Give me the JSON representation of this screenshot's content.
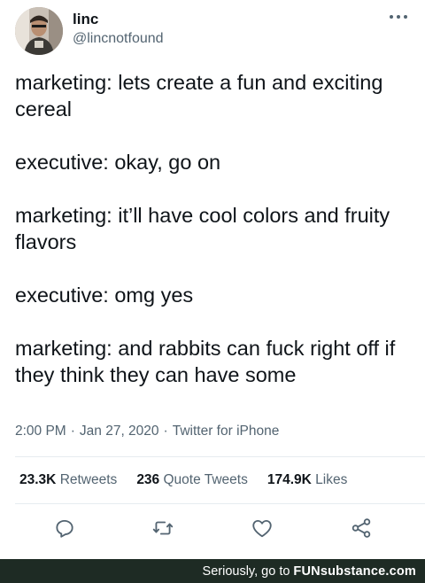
{
  "tweet": {
    "display_name": "linc",
    "handle": "@lincnotfound",
    "lines": [
      "marketing: lets create a fun and exciting cereal",
      "executive: okay, go on",
      "marketing: it’ll have cool colors and fruity flavors",
      "executive: omg yes",
      "marketing: and rabbits can fuck right off if they think they can have some"
    ],
    "time": "2:00 PM",
    "date": "Jan 27, 2020",
    "source": "Twitter for iPhone",
    "separator": "·",
    "stats": {
      "retweets_count": "23.3K",
      "retweets_label": "Retweets",
      "quote_count": "236",
      "quote_label": "Quote Tweets",
      "likes_count": "174.9K",
      "likes_label": "Likes"
    }
  },
  "icons": {
    "more": "more-icon",
    "reply": "reply-icon",
    "retweet": "retweet-icon",
    "like": "heart-icon",
    "share": "share-icon"
  },
  "footer": {
    "text": "Seriously, go to",
    "brand": "FUNsubstance.com"
  },
  "colors": {
    "text": "#0f1419",
    "muted": "#536471",
    "footer_bg": "#1e2b24"
  }
}
